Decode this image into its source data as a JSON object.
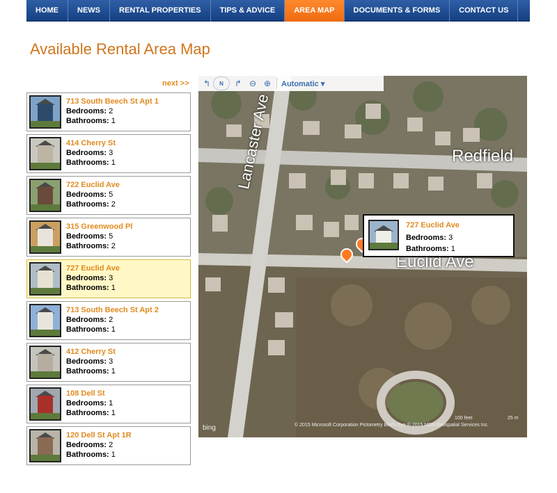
{
  "nav": {
    "items": [
      {
        "label": "HOME",
        "active": false
      },
      {
        "label": "NEWS",
        "active": false
      },
      {
        "label": "RENTAL PROPERTIES",
        "active": false
      },
      {
        "label": "TIPS & ADVICE",
        "active": false
      },
      {
        "label": "AREA MAP",
        "active": true
      },
      {
        "label": "DOCUMENTS & FORMS",
        "active": false
      },
      {
        "label": "CONTACT US",
        "active": false
      }
    ]
  },
  "page_title": "Available Rental Area Map",
  "next_link": "next >>",
  "bedrooms_label": "Bedrooms:",
  "bathrooms_label": "Bathrooms:",
  "listings": [
    {
      "address": "713 South Beech St Apt 1",
      "bedrooms": "2",
      "bathrooms": "1",
      "selected": false
    },
    {
      "address": "414 Cherry St",
      "bedrooms": "3",
      "bathrooms": "1",
      "selected": false
    },
    {
      "address": "722 Euclid Ave",
      "bedrooms": "5",
      "bathrooms": "2",
      "selected": false
    },
    {
      "address": "315 Greenwood Pl",
      "bedrooms": "5",
      "bathrooms": "2",
      "selected": false
    },
    {
      "address": "727 Euclid Ave",
      "bedrooms": "3",
      "bathrooms": "1",
      "selected": true
    },
    {
      "address": "713 South Beech St Apt 2",
      "bedrooms": "2",
      "bathrooms": "1",
      "selected": false
    },
    {
      "address": "412 Cherry St",
      "bedrooms": "3",
      "bathrooms": "1",
      "selected": false
    },
    {
      "address": "108 Dell St",
      "bedrooms": "1",
      "bathrooms": "1",
      "selected": false
    },
    {
      "address": "120 Dell St Apt 1R",
      "bedrooms": "2",
      "bathrooms": "1",
      "selected": false
    }
  ],
  "map": {
    "view_mode": "Automatic",
    "compass_label": "N",
    "popup": {
      "address": "727 Euclid Ave",
      "bedrooms": "3",
      "bathrooms": "1"
    },
    "street_labels": [
      "Lancaster Ave",
      "Redfield",
      "Euclid Ave"
    ],
    "scale_feet": "100 feet",
    "scale_m": "25 m",
    "copyright": "© 2015 Microsoft Corporation   Pictometry Bird's Eye © 2015 MDA Geospatial Services Inc.",
    "provider": "bing"
  },
  "colors": {
    "accent": "#e08a1e",
    "nav": "#1f4f94",
    "nav_active": "#f47a1f",
    "selected_bg": "#fff8c6"
  }
}
